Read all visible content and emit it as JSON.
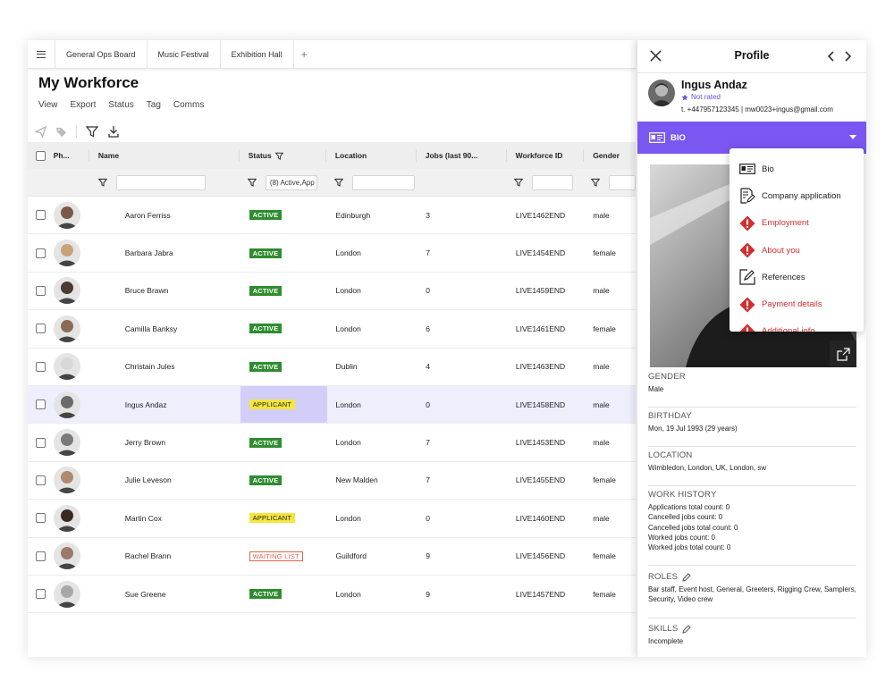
{
  "tabs": [
    "General Ops Board",
    "Music Festival",
    "Exhibition Hall"
  ],
  "tab_add": "+",
  "page_title": "My Workforce",
  "menu": [
    "View",
    "Export",
    "Status",
    "Tag",
    "Comms"
  ],
  "columns": {
    "photo": "Ph...",
    "name": "Name",
    "status": "Status",
    "location": "Location",
    "jobs": "Jobs (last 90...",
    "workforce_id": "Workforce ID",
    "gender": "Gender"
  },
  "status_filter_value": "(8) Active,App",
  "rows": [
    {
      "name": "Aaron Ferriss",
      "status": "ACTIVE",
      "status_type": "active",
      "location": "Edinburgh",
      "jobs": "3",
      "wid": "LIVE1462END",
      "gender": "male"
    },
    {
      "name": "Barbara Jabra",
      "status": "ACTIVE",
      "status_type": "active",
      "location": "London",
      "jobs": "7",
      "wid": "LIVE1454END",
      "gender": "female"
    },
    {
      "name": "Bruce Brawn",
      "status": "ACTIVE",
      "status_type": "active",
      "location": "London",
      "jobs": "0",
      "wid": "LIVE1459END",
      "gender": "male"
    },
    {
      "name": "Camilla Banksy",
      "status": "ACTIVE",
      "status_type": "active",
      "location": "London",
      "jobs": "6",
      "wid": "LIVE1461END",
      "gender": "female"
    },
    {
      "name": "Christain Jules",
      "status": "ACTIVE",
      "status_type": "active",
      "location": "Dublin",
      "jobs": "4",
      "wid": "LIVE1463END",
      "gender": "male"
    },
    {
      "name": "Ingus Andaz",
      "status": "APPLICANT",
      "status_type": "applicant",
      "location": "London",
      "jobs": "0",
      "wid": "LIVE1458END",
      "gender": "male",
      "selected": true
    },
    {
      "name": "Jerry Brown",
      "status": "ACTIVE",
      "status_type": "active",
      "location": "London",
      "jobs": "7",
      "wid": "LIVE1453END",
      "gender": "male"
    },
    {
      "name": "Julie Leveson",
      "status": "ACTIVE",
      "status_type": "active",
      "location": "New Malden",
      "jobs": "7",
      "wid": "LIVE1455END",
      "gender": "female"
    },
    {
      "name": "Martin Cox",
      "status": "APPLICANT",
      "status_type": "applicant",
      "location": "London",
      "jobs": "0",
      "wid": "LIVE1460END",
      "gender": "male"
    },
    {
      "name": "Rachel Brann",
      "status": "WAITING LIST",
      "status_type": "waiting",
      "location": "Guildford",
      "jobs": "9",
      "wid": "LIVE1456END",
      "gender": "female"
    },
    {
      "name": "Sue Greene",
      "status": "ACTIVE",
      "status_type": "active",
      "location": "London",
      "jobs": "9",
      "wid": "LIVE1457END",
      "gender": "female"
    }
  ],
  "profile": {
    "title": "Profile",
    "name": "Ingus Andaz",
    "rating": "Not rated",
    "contact": "t. +447957123345 | mw0023+ingus@gmail.com",
    "section_bar": "BIO",
    "dropdown": [
      {
        "label": "Bio",
        "icon": "id-card-icon",
        "warn": false
      },
      {
        "label": "Company application",
        "icon": "form-edit-icon",
        "warn": false
      },
      {
        "label": "Employment",
        "icon": "warning-icon",
        "warn": true
      },
      {
        "label": "About you",
        "icon": "warning-icon",
        "warn": true
      },
      {
        "label": "References",
        "icon": "edit-icon",
        "warn": false
      },
      {
        "label": "Payment details",
        "icon": "warning-icon",
        "warn": true
      },
      {
        "label": "Additional info",
        "icon": "warning-icon",
        "warn": true
      }
    ],
    "gender_label": "GENDER",
    "gender": "Male",
    "birthday_label": "BIRTHDAY",
    "birthday": "Mon, 19 Jul 1993 (29 years)",
    "location_label": "LOCATION",
    "location": "Wimbledon, London, UK, London, sw",
    "work_history_label": "WORK HISTORY",
    "work_history": [
      "Applications total count: 0",
      "Cancelled jobs count: 0",
      "Cancelled jobs total count: 0",
      "Worked jobs count: 0",
      "Worked jobs total count: 0"
    ],
    "roles_label": "ROLES",
    "roles": "Bar staff, Event host, General, Greeters, Rigging Crew, Samplers, Security, Video crew",
    "skills_label": "SKILLS",
    "skills": "Incomplete"
  },
  "colors": {
    "accent": "#7a57f0",
    "active": "#2f8c2f",
    "applicant": "#f4e63c",
    "waiting": "#e0664a",
    "warning": "#d12f2f"
  }
}
